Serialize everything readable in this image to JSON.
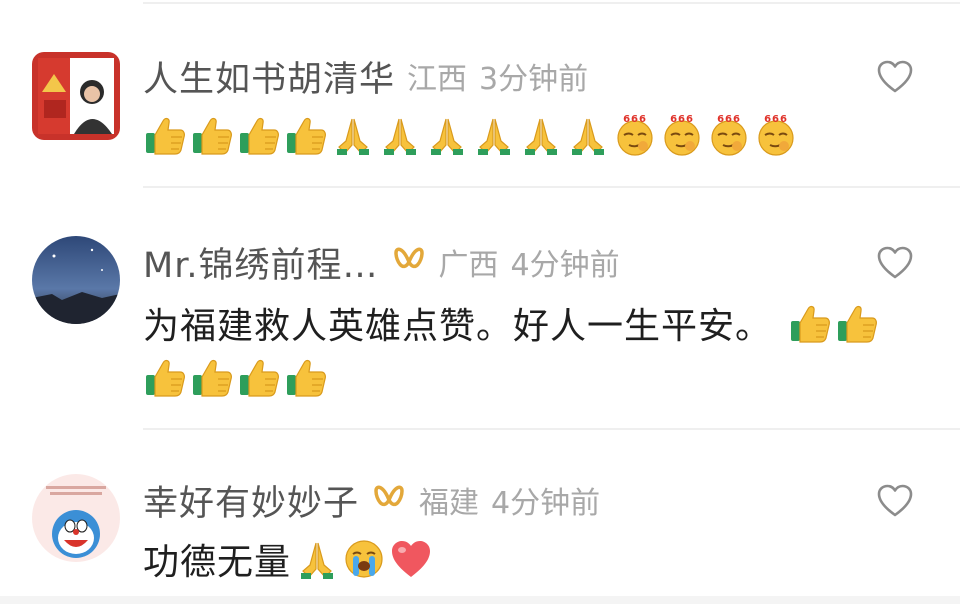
{
  "comments": [
    {
      "username": "人生如书胡清华",
      "region": "江西",
      "time": "3分钟前",
      "vip": false,
      "avatar": "red-square-photo-avatar",
      "text": "",
      "emoji_line1": [
        "thumbs-up",
        "thumbs-up",
        "thumbs-up",
        "thumbs-up",
        "folded-hands",
        "folded-hands",
        "folded-hands",
        "folded-hands",
        "folded-hands",
        "folded-hands",
        "666-face",
        "666-face",
        "666-face",
        "666-face"
      ],
      "emoji_line2": []
    },
    {
      "username": "Mr.锦绣前程…",
      "region": "广西",
      "time": "4分钟前",
      "vip": true,
      "avatar": "blue-night-sky-avatar",
      "text": "为福建救人英雄点赞。好人一生平安。",
      "emoji_line1": [
        "thumbs-up",
        "thumbs-up"
      ],
      "emoji_line2": [
        "thumbs-up",
        "thumbs-up",
        "thumbs-up",
        "thumbs-up"
      ]
    },
    {
      "username": "幸好有妙妙子",
      "region": "福建",
      "time": "4分钟前",
      "vip": true,
      "avatar": "doraemon-avatar",
      "text": "功德无量",
      "emoji_line1": [
        "folded-hands",
        "crying-face",
        "red-heart"
      ],
      "emoji_line2": []
    }
  ],
  "colors": {
    "username": "#555555",
    "meta": "#a8a8a8",
    "text": "#1f1f1f",
    "vip_gold": "#e3a83a",
    "like_icon": "#8c8c8c",
    "divider": "#efefef"
  },
  "icons": {
    "like": "heart-outline-icon",
    "vip": "vip-badge-icon"
  }
}
